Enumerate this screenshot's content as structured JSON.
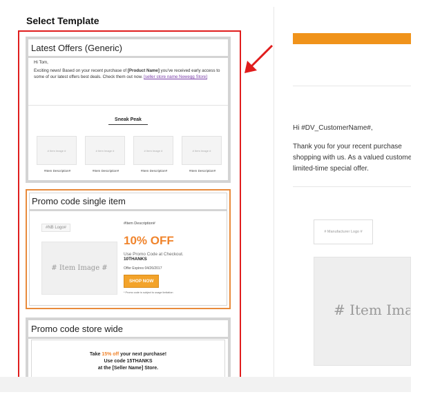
{
  "page": {
    "heading": "Select Template"
  },
  "templates": [
    {
      "title": "Latest Offers (Generic)",
      "greeting": "Hi Tom,",
      "body_before": "Exciting news! Based on your recent purchase of ",
      "product": "[Product Name]",
      "body_after": " you've received early access to some of our latest offers best deals. Check them out now. ",
      "store_link": "[seller store name Newegg Store]",
      "sneak_label": "Sneak Peak",
      "items": [
        {
          "image": "# Item Image #",
          "desc": "#Item Description#"
        },
        {
          "image": "# Item Image #",
          "desc": "#Item Description#"
        },
        {
          "image": "# Item Image #",
          "desc": "#Item Description#"
        },
        {
          "image": "# Item Image #",
          "desc": "#Item Description#"
        }
      ]
    },
    {
      "title": "Promo code single item",
      "logo": "#NB Logo#",
      "image": "# Item Image #",
      "desc": "#Item Description#",
      "discount": "10% OFF",
      "use_text": "Use Promo Code at Checkout.",
      "code": "10THANKS",
      "expires": "Offer Expires 04/26/2017",
      "button": "SHOP NOW",
      "fine_print": "* Promo code is subject to usage limitation"
    },
    {
      "title": "Promo code store wide",
      "line1_before": "Take ",
      "line1_pct": "15% off",
      "line1_after": " your next purchase!",
      "line2": "Use code 15THANKS",
      "line3": "at the [Seller Name] Store."
    }
  ],
  "preview": {
    "greeting": "Hi #DV_CustomerName#,",
    "line1": "Thank you for your recent purchase",
    "line2": "shopping with us. As a valued customer",
    "line3": "limited-time special offer.",
    "manufacturer_logo": "# Manufacturer Logo #",
    "item_image": "# Item Image #"
  },
  "colors": {
    "highlight": "#e01c1c",
    "accent_orange": "#f0842c",
    "selected_border": "#e88a3a"
  }
}
